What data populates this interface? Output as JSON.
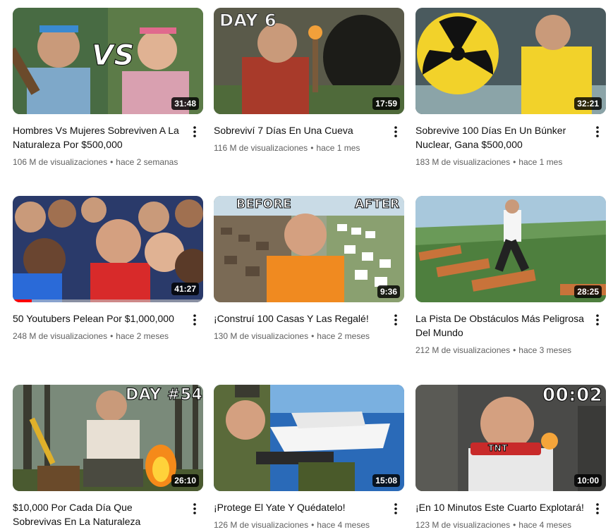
{
  "videos": [
    {
      "title": "Hombres Vs Mujeres Sobreviven A La Naturaleza Por $500,000",
      "views": "106 M de visualizaciones",
      "age": "hace 2 semanas",
      "duration": "31:48",
      "overlay": "VS",
      "progress_percent": 0
    },
    {
      "title": "Sobreviví 7 Días En Una Cueva",
      "views": "116 M de visualizaciones",
      "age": "hace 1 mes",
      "duration": "17:59",
      "overlay": "DAY 6",
      "progress_percent": 0
    },
    {
      "title": "Sobrevive 100 Días En Un Búnker Nuclear, Gana $500,000",
      "views": "183 M de visualizaciones",
      "age": "hace 1 mes",
      "duration": "32:21",
      "overlay": "",
      "progress_percent": 0
    },
    {
      "title": "50 Youtubers Pelean Por $1,000,000",
      "views": "248 M de visualizaciones",
      "age": "hace 2 meses",
      "duration": "41:27",
      "overlay": "",
      "progress_percent": 10
    },
    {
      "title": "¡Construí 100 Casas Y Las Regalé!",
      "views": "130 M de visualizaciones",
      "age": "hace 2 meses",
      "duration": "9:36",
      "overlay": "BEFORE",
      "overlay2": "AFTER",
      "progress_percent": 0
    },
    {
      "title": "La Pista De Obstáculos Más Peligrosa Del Mundo",
      "views": "212 M de visualizaciones",
      "age": "hace 3 meses",
      "duration": "28:25",
      "overlay": "",
      "progress_percent": 0
    },
    {
      "title": "$10,000 Por Cada Día Que Sobrevivas En La Naturaleza",
      "views": "",
      "age": "",
      "duration": "26:10",
      "overlay": "DAY #54",
      "progress_percent": 0
    },
    {
      "title": "¡Protege El Yate Y Quédatelo!",
      "views": "126 M de visualizaciones",
      "age": "hace 4 meses",
      "duration": "15:08",
      "overlay": "",
      "progress_percent": 0
    },
    {
      "title": "¡En 10 Minutos Este Cuarto Explotará!",
      "views": "123 M de visualizaciones",
      "age": "hace 4 meses",
      "duration": "10:00",
      "overlay": "00:02",
      "overlay2": "TNT",
      "progress_percent": 0
    }
  ],
  "colors": {
    "progress": "#ff0000",
    "text_primary": "#0f0f0f",
    "text_secondary": "#606060"
  },
  "icons": {
    "more": "more-vert-icon"
  }
}
